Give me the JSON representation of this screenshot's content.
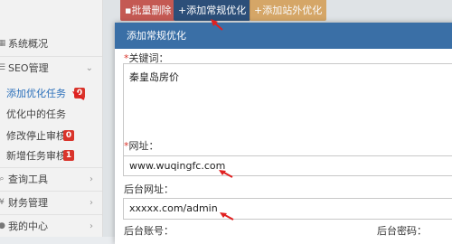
{
  "toolbar": {
    "delete_label": "批量删除",
    "delete_icon": "trash-icon",
    "add_label": "+添加常规优化",
    "add_external_label": "+添加站外优化"
  },
  "sidebar": {
    "items": [
      {
        "label": "系统概况",
        "icon": "dashboard-icon"
      },
      {
        "label": "SEO管理",
        "icon": "list-icon",
        "expanded": true
      },
      {
        "label": "查询工具",
        "icon": "search-icon"
      },
      {
        "label": "财务管理",
        "icon": "money-icon"
      },
      {
        "label": "我的中心",
        "icon": "user-icon"
      }
    ],
    "sub_items": [
      {
        "label": "添加优化任务",
        "badge": "0",
        "active": true
      },
      {
        "label": "优化中的任务",
        "badge": ""
      },
      {
        "label": "修改停止审核",
        "badge": "0"
      },
      {
        "label": "新增任务审核",
        "badge": "1"
      }
    ]
  },
  "dialog": {
    "title": "添加常规优化",
    "keywords_label": "关键词：",
    "keywords_value": "秦皇岛房价",
    "url_label": "网址：",
    "url_value": "www.wuqingfc.com",
    "admin_url_label": "后台网址：",
    "admin_url_value": "xxxxx.com/admin",
    "admin_account_label": "后台账号：",
    "admin_password_label": "后台密码："
  },
  "colors": {
    "accent_blue": "#3a6fa6",
    "badge_red": "#d9342b",
    "delete_red": "#c0413a",
    "add_blue": "#2c4f79",
    "external_orange": "#d49c52",
    "annotation_arrow": "#e02020"
  }
}
